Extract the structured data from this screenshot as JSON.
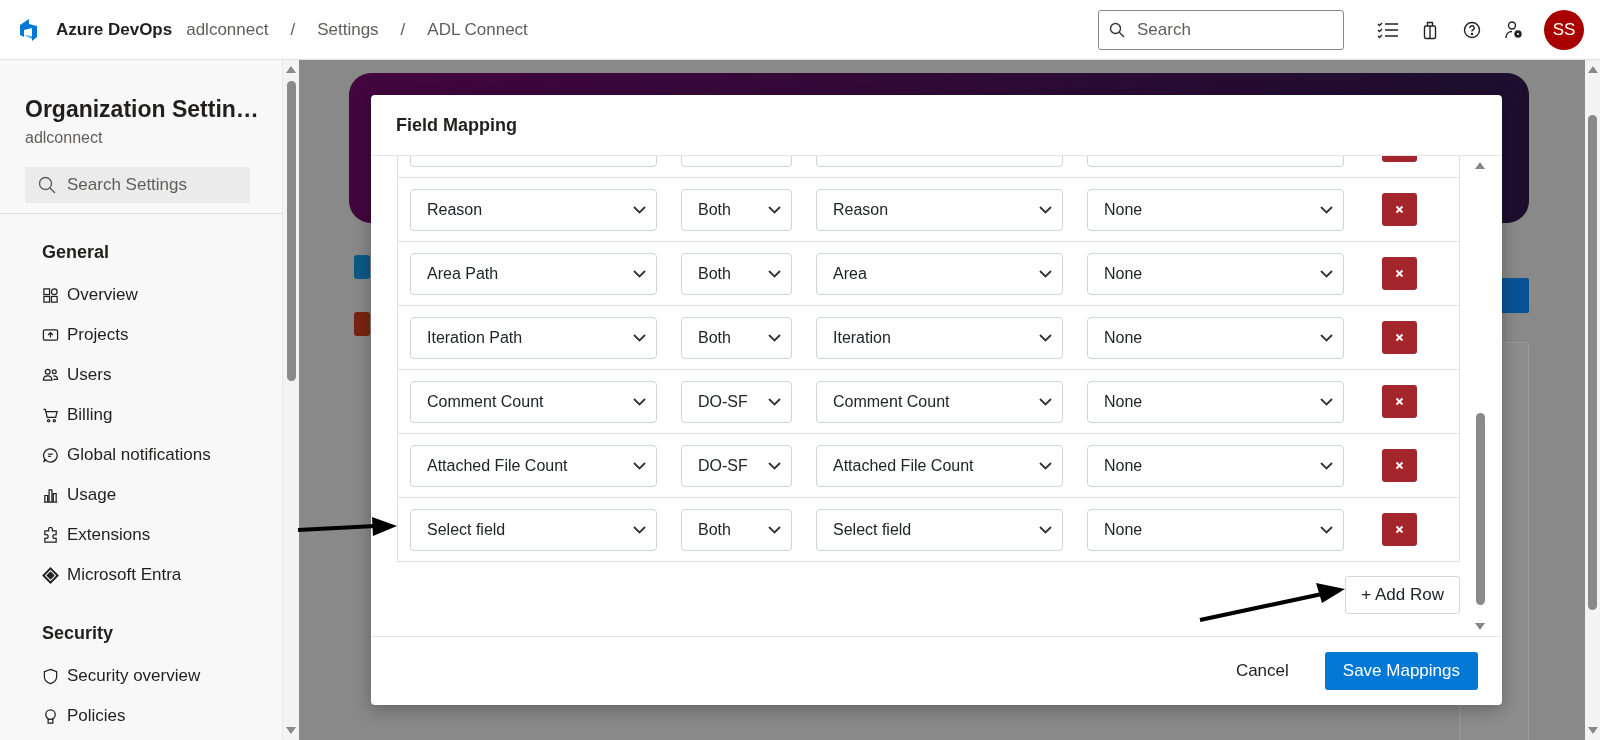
{
  "top_bar": {
    "product": "Azure DevOps",
    "breadcrumbs": [
      "adlconnect",
      "/",
      "Settings",
      "/",
      "ADL Connect"
    ],
    "search": {
      "placeholder": "Search"
    },
    "avatar": "SS"
  },
  "sidebar": {
    "title": "Organization Settin…",
    "subtitle": "adlconnect",
    "search": {
      "placeholder": "Search Settings"
    },
    "sections": [
      {
        "heading": "General",
        "items": [
          {
            "label": "Overview"
          },
          {
            "label": "Projects"
          },
          {
            "label": "Users"
          },
          {
            "label": "Billing"
          },
          {
            "label": "Global notifications"
          },
          {
            "label": "Usage"
          },
          {
            "label": "Extensions"
          },
          {
            "label": "Microsoft Entra"
          }
        ]
      },
      {
        "heading": "Security",
        "items": [
          {
            "label": "Security overview"
          },
          {
            "label": "Policies"
          }
        ]
      }
    ]
  },
  "dialog": {
    "title": "Field Mapping",
    "rows": [
      {
        "column_1": "Reason",
        "column_2": "Both",
        "column_3": "Reason",
        "column_4": "None"
      },
      {
        "column_1": "Area Path",
        "column_2": "Both",
        "column_3": "Area",
        "column_4": "None"
      },
      {
        "column_1": "Iteration Path",
        "column_2": "Both",
        "column_3": "Iteration",
        "column_4": "None"
      },
      {
        "column_1": "Comment Count",
        "column_2": "DO-SF",
        "column_3": "Comment Count",
        "column_4": "None"
      },
      {
        "column_1": "Attached File Count",
        "column_2": "DO-SF",
        "column_3": "Attached File Count",
        "column_4": "None"
      },
      {
        "column_1": "Select field",
        "column_2": "Both",
        "column_3": "Select field",
        "column_4": "None"
      }
    ],
    "add_button": "+ Add Row",
    "cancel_button": "Cancel",
    "save_button": "Save Mappings"
  }
}
